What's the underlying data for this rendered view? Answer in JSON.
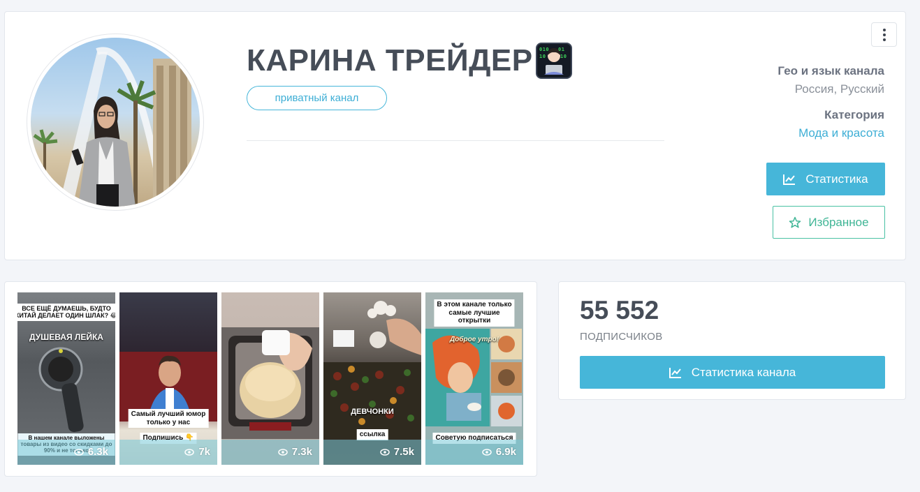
{
  "profile": {
    "title": "КАРИНА ТРЕЙДЕР",
    "title_emoji_icon": "technologist-woman-emoji",
    "private_badge": "приватный канал",
    "geo_label": "Гео и язык канала",
    "geo_value": "Россия, Русский",
    "category_label": "Категория",
    "category_value": "Мода и красота",
    "stats_button": "Статистика",
    "favorite_button": "Избранное",
    "menu_icon": "kebab-menu-icon"
  },
  "media": {
    "thumbnails": [
      {
        "views": "6.3k",
        "caption_top": "ВСЕ ЕЩЁ ДУМАЕШЬ, БУДТО\nКИТАЙ ДЕЛАЕТ ОДИН ШЛАК? 😂",
        "caption_mid": "ДУШЕВАЯ ЛЕЙКА",
        "caption_bottom": "В нашем канале выложены\nтовары из видео со скидками до\n90% и не только"
      },
      {
        "views": "7k",
        "caption_top": "Самый лучший юмор\nтолько у нас",
        "caption_bottom": "Подпишись 👇"
      },
      {
        "views": "7.3k"
      },
      {
        "views": "7.5k",
        "caption_top": "ДЕВЧОНКИ",
        "caption_bottom": "ссылка"
      },
      {
        "views": "6.9k",
        "caption_top": "В этом канале только\nсамые лучшие\nоткрытки",
        "caption_mid": "Доброе утро!",
        "caption_bottom": "Советую подписаться"
      }
    ]
  },
  "stats": {
    "subscribers": "55 552",
    "subscribers_label": "ПОДПИСЧИКОВ",
    "channel_stats_button": "Статистика канала"
  },
  "colors": {
    "accent": "#46b6d9",
    "favorite": "#3fb595",
    "title": "#464d58"
  }
}
